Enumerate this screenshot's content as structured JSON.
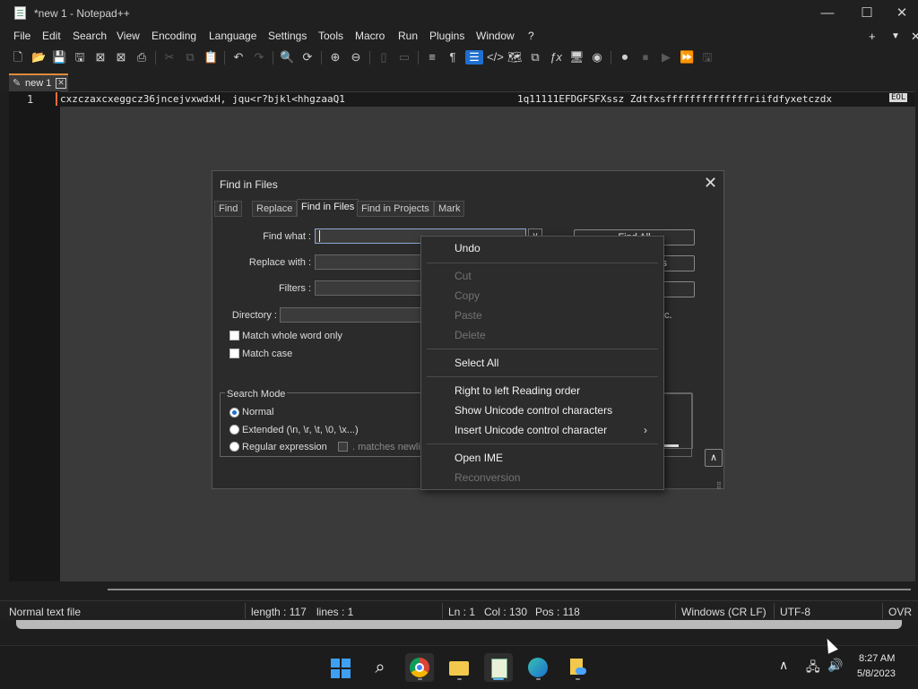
{
  "window": {
    "title": "*new 1 - Notepad++",
    "minimize": "—",
    "maximize": "☐",
    "close": "✕"
  },
  "menu": {
    "items": [
      "File",
      "Edit",
      "Search",
      "View",
      "Encoding",
      "Language",
      "Settings",
      "Tools",
      "Macro",
      "Run",
      "Plugins",
      "Window",
      "?"
    ],
    "right": {
      "plus": "+",
      "dropdown": "▼",
      "close": "✕"
    }
  },
  "tab": {
    "label": "new 1",
    "close": "✕",
    "pen": "✎"
  },
  "editor": {
    "line_number": "1",
    "text_left": "cxzczaxcxeggcz36jncejvxwdxH, jqu<r?bjkl<hhgzaaQ1",
    "text_right": "1q11111EFDGFSFXssz Zdtfxsffffffffffffffriifdfyxetczdx",
    "eol": "EOL"
  },
  "dialog": {
    "title": "Find in Files",
    "close": "✕",
    "tabs": [
      "Find",
      "Replace",
      "Find in Files",
      "Find in Projects",
      "Mark"
    ],
    "active_tab": "Find in Files",
    "labels": {
      "find_what": "Find what :",
      "replace_with": "Replace with :",
      "filters": "Filters :",
      "directory": "Directory :"
    },
    "find_what_value": "",
    "dropdown": "∨",
    "checkboxes": {
      "whole_word": "Match whole word only",
      "match_case": "Match case"
    },
    "search_mode": {
      "title": "Search Mode",
      "normal": "Normal",
      "extended": "Extended (\\n, \\r, \\t, \\0, \\x...)",
      "regex": "Regular expression",
      "dot_newline": ". matches newline",
      "selected": "Normal"
    },
    "find_all_button": "Find All",
    "partial_right_1": "s",
    "partial_right_2": "c.",
    "up_button": "∧"
  },
  "context_menu": {
    "undo": "Undo",
    "cut": "Cut",
    "copy": "Copy",
    "paste": "Paste",
    "delete": "Delete",
    "select_all": "Select All",
    "rtl": "Right to left Reading order",
    "show_unicode": "Show Unicode control characters",
    "insert_unicode": "Insert Unicode control character",
    "open_ime": "Open IME",
    "reconversion": "Reconversion",
    "submenu_arrow": "›"
  },
  "status": {
    "file_type": "Normal text file",
    "length": "length : 117",
    "lines": "lines : 1",
    "ln": "Ln : 1",
    "col": "Col : 130",
    "pos": "Pos : 118",
    "eol": "Windows (CR LF)",
    "encoding": "UTF-8",
    "mode": "OVR"
  },
  "taskbar": {
    "tray_chevron": "∧",
    "time": "8:27 AM",
    "date": "5/8/2023"
  },
  "colors": {
    "accent": "#1f6fd1",
    "caret": "#ff6a3c",
    "tab_accent": "#e08a3c",
    "editor_bg": "#3a3a3a"
  }
}
